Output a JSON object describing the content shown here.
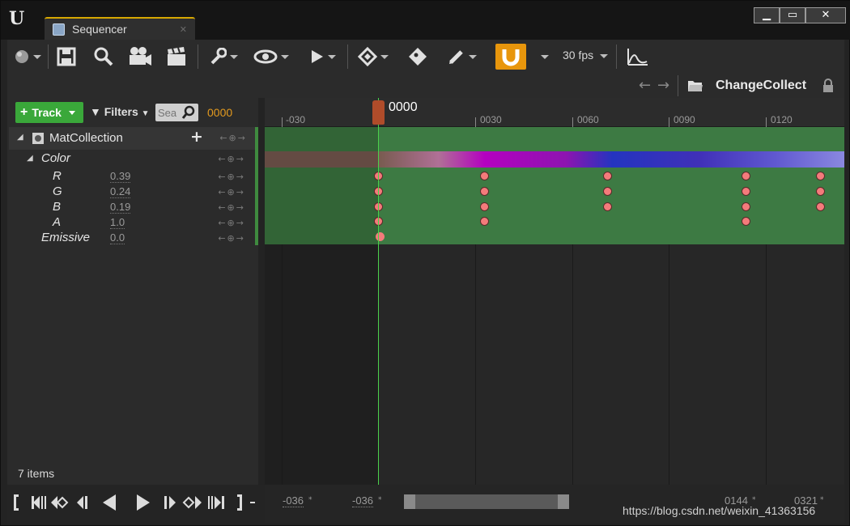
{
  "window": {
    "tab_title": "Sequencer",
    "controls": {
      "minimize": "▁",
      "maximize": "▭",
      "close": "✕"
    }
  },
  "toolbar": {
    "fps_label": "30 fps",
    "icons": [
      "world-icon",
      "save-icon",
      "search-icon",
      "camera-icon",
      "clapper-icon",
      "wrench-icon",
      "eye-icon",
      "play-icon",
      "keyframe-icon",
      "key-tag-icon",
      "pencil-icon",
      "magnet-icon",
      "curve-icon"
    ]
  },
  "nav": {
    "sequence_name": "ChangeCollect"
  },
  "tracks_panel": {
    "track_button": "Track",
    "filters_label": "Filters",
    "search_placeholder": "Sea",
    "current_time": "0000",
    "object_name": "MatCollection",
    "color_group": "Color",
    "params": [
      {
        "name": "R",
        "value": "0.39"
      },
      {
        "name": "G",
        "value": "0.24"
      },
      {
        "name": "B",
        "value": "0.19"
      },
      {
        "name": "A",
        "value": "1.0"
      }
    ],
    "emissive": {
      "name": "Emissive",
      "value": "0.0"
    },
    "items_count": "7 items"
  },
  "timeline": {
    "playhead_time": "0000",
    "ticks": [
      "-030",
      "0030",
      "0060",
      "0090",
      "0120"
    ],
    "range_start": "-036",
    "range_start2": "-036",
    "view_end": "0144",
    "range_end": "0321"
  },
  "watermark": "https://blog.csdn.net/weixin_41363156"
}
